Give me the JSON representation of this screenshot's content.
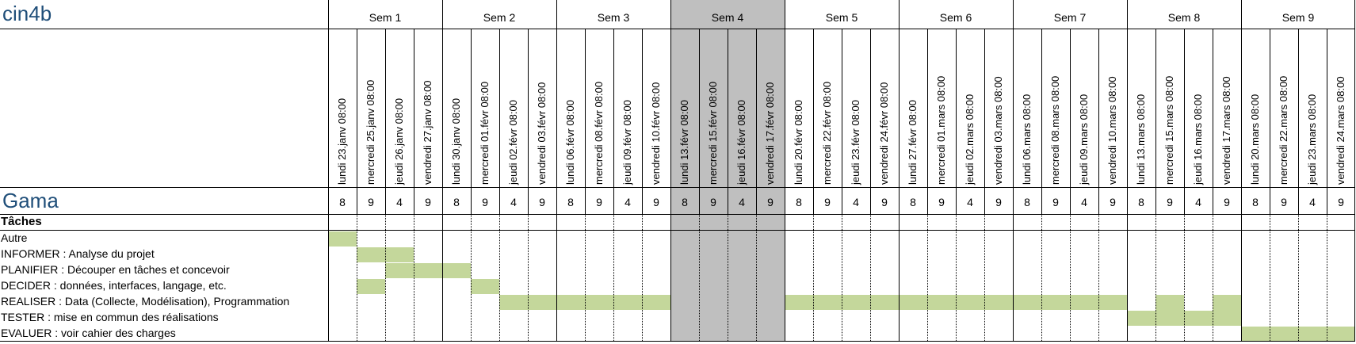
{
  "project": "cin4b",
  "team": "Gama",
  "tasks_header": "Tâches",
  "colors": {
    "bar": "#c4d79b",
    "week_highlight": "#bfbfbf",
    "title": "#1f4e79",
    "grid": "#000000"
  },
  "weeks": [
    {
      "label": "Sem 1",
      "highlight": false
    },
    {
      "label": "Sem 2",
      "highlight": false
    },
    {
      "label": "Sem 3",
      "highlight": false
    },
    {
      "label": "Sem 4",
      "highlight": true
    },
    {
      "label": "Sem 5",
      "highlight": false
    },
    {
      "label": "Sem 6",
      "highlight": false
    },
    {
      "label": "Sem 7",
      "highlight": false
    },
    {
      "label": "Sem 8",
      "highlight": false
    },
    {
      "label": "Sem 9",
      "highlight": false
    }
  ],
  "days": [
    "lundi 23.janv 08:00",
    "mercredi 25.janv 08:00",
    "jeudi 26.janv 08:00",
    "vendredi 27.janv 08:00",
    "lundi 30.janv 08:00",
    "mercredi 01.févr 08:00",
    "jeudi 02.févr 08:00",
    "vendredi 03.févr 08:00",
    "lundi 06.févr 08:00",
    "mercredi 08.févr 08:00",
    "jeudi 09.févr 08:00",
    "vendredi 10.févr 08:00",
    "lundi 13.févr 08:00",
    "mercredi 15.févr 08:00",
    "jeudi 16.févr 08:00",
    "vendredi 17.févr 08:00",
    "lundi 20.févr 08:00",
    "mercredi 22.févr 08:00",
    "jeudi 23.févr 08:00",
    "vendredi 24.févr 08:00",
    "lundi 27.févr 08:00",
    "mercredi 01.mars 08:00",
    "jeudi 02.mars 08:00",
    "vendredi 03.mars 08:00",
    "lundi 06.mars 08:00",
    "mercredi 08.mars 08:00",
    "jeudi 09.mars 08:00",
    "vendredi 10.mars 08:00",
    "lundi 13.mars 08:00",
    "mercredi 15.mars 08:00",
    "jeudi 16.mars 08:00",
    "vendredi 17.mars 08:00",
    "lundi 20.mars 08:00",
    "mercredi 22.mars 08:00",
    "jeudi 23.mars 08:00",
    "vendredi 24.mars 08:00"
  ],
  "hours": [
    "8",
    "9",
    "4",
    "9",
    "8",
    "9",
    "4",
    "9",
    "8",
    "9",
    "4",
    "9",
    "8",
    "9",
    "4",
    "9",
    "8",
    "9",
    "4",
    "9",
    "8",
    "9",
    "4",
    "9",
    "8",
    "9",
    "4",
    "9",
    "8",
    "9",
    "4",
    "9",
    "8",
    "9",
    "4",
    "9"
  ],
  "tasks": [
    {
      "label": "Autre",
      "days": [
        0
      ]
    },
    {
      "label": "INFORMER : Analyse du projet",
      "days": [
        1,
        2
      ]
    },
    {
      "label": "PLANIFIER : Découper en tâches et concevoir",
      "days": [
        2,
        3,
        4
      ]
    },
    {
      "label": "DECIDER : données, interfaces, langage, etc.",
      "days": [
        1,
        5
      ]
    },
    {
      "label": "REALISER : Data (Collecte, Modélisation), Programmation",
      "days": [
        6,
        7,
        8,
        9,
        10,
        11,
        16,
        17,
        18,
        19,
        20,
        21,
        22,
        23,
        24,
        25,
        26,
        27
      ]
    },
    {
      "label": "TESTER : mise en commun des réalisations",
      "days": [
        28,
        29,
        30,
        31
      ]
    },
    {
      "label": "EVALUER : voir cahier des charges",
      "days": [
        32,
        33,
        34,
        35
      ]
    }
  ],
  "task_bars_upper": {
    "4": [
      29,
      31
    ]
  }
}
